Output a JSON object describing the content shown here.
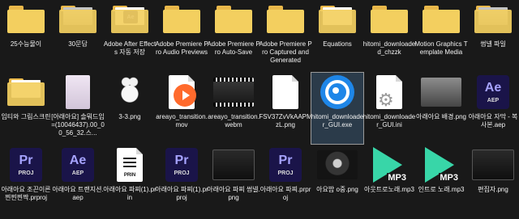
{
  "files": [
    {
      "name": "25수능물이",
      "type": "folder",
      "row": 0,
      "col": 0
    },
    {
      "name": "30문답",
      "type": "folder",
      "row": 0,
      "col": 1,
      "badge": "photo"
    },
    {
      "name": "Adobe After Effects 자동 저장",
      "type": "folder",
      "row": 0,
      "col": 2,
      "badge": "Ae"
    },
    {
      "name": "Adobe Premiere Pro Audio Previews",
      "type": "folder",
      "row": 0,
      "col": 3
    },
    {
      "name": "Adobe Premiere Pro Auto-Save",
      "type": "folder",
      "row": 0,
      "col": 4
    },
    {
      "name": "Adobe Premiere Pro Captured and Generated",
      "type": "folder",
      "row": 0,
      "col": 5
    },
    {
      "name": "Equations",
      "type": "folder",
      "row": 0,
      "col": 6,
      "badge": "paper"
    },
    {
      "name": "hitomi_downloaded_chzzk",
      "type": "folder",
      "row": 0,
      "col": 7
    },
    {
      "name": "Motion Graphics Template Media",
      "type": "folder",
      "row": 0,
      "col": 8
    },
    {
      "name": "썸넬 파일",
      "type": "folder",
      "row": 0,
      "col": 9,
      "badge": "photo"
    },
    {
      "name": "임티와 그림스크린",
      "type": "folder",
      "row": 1,
      "col": 0,
      "badge": "paper"
    },
    {
      "name": "[아래아요] 솔뭐드임=(10046437).00_00_56_32.스...",
      "type": "portrait",
      "row": 1,
      "col": 1
    },
    {
      "name": "3-3.png",
      "type": "bunny",
      "row": 1,
      "col": 2
    },
    {
      "name": "areayo_transition.mov",
      "type": "media",
      "row": 1,
      "col": 3
    },
    {
      "name": "areayo_transition.webm",
      "type": "video",
      "row": 1,
      "col": 4
    },
    {
      "name": "FSV37ZvVkAAPMzL.png",
      "type": "doc",
      "row": 1,
      "col": 5
    },
    {
      "name": "hitomi_downloader_GUI.exe",
      "type": "exe",
      "row": 1,
      "col": 6,
      "selected": true
    },
    {
      "name": "hitomi_downloader_GUI.ini",
      "type": "ini",
      "row": 1,
      "col": 7
    },
    {
      "name": "아래아요 배경.png",
      "type": "photo",
      "row": 1,
      "col": 8
    },
    {
      "name": "아래아요 자막 - 복사본.aep",
      "type": "ae",
      "row": 1,
      "col": 9
    },
    {
      "name": "아래아요 조끈이른 찐찐찐짝.prproj",
      "type": "pr",
      "row": 2,
      "col": 0
    },
    {
      "name": "아래아요 트랜지션.aep",
      "type": "ae",
      "row": 2,
      "col": 1
    },
    {
      "name": "아래아요 파찌(1).prin",
      "type": "print",
      "row": 2,
      "col": 2
    },
    {
      "name": "아래아요 파찌(1).prproj",
      "type": "pr",
      "row": 2,
      "col": 3
    },
    {
      "name": "아래아요 파찌 썸넬.png",
      "type": "screen",
      "row": 2,
      "col": 4
    },
    {
      "name": "아래아요 파찌.prproj",
      "type": "pr",
      "row": 2,
      "col": 5
    },
    {
      "name": "아요밥 o중.png",
      "type": "dark",
      "row": 2,
      "col": 6
    },
    {
      "name": "아웃트로노래.mp3",
      "type": "mp3",
      "row": 2,
      "col": 7
    },
    {
      "name": "인트로 노래.mp3",
      "type": "mp3",
      "row": 2,
      "col": 8
    },
    {
      "name": "편집자.png",
      "type": "screen",
      "row": 2,
      "col": 9
    }
  ],
  "tile_text": {
    "pr": "Pr",
    "ae": "Ae",
    "proj": "PROJ",
    "aep": "AEP",
    "print": "PRIN",
    "mp3": "MP3",
    "folder_ae": "Ae"
  },
  "colors": {
    "background": "#191919",
    "folder": "#f3cf5f",
    "premiere": "#1a1449",
    "mp3": "#38d6a8",
    "exe": "#1e86e8"
  }
}
